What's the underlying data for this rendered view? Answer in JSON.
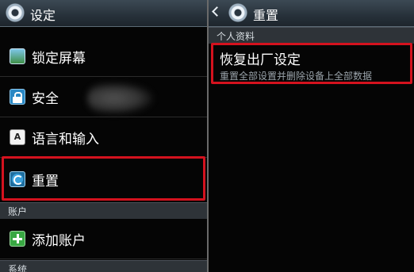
{
  "left": {
    "title": "设定",
    "items": [
      {
        "label": "锁定屏幕",
        "icon": "screen-lock-icon"
      },
      {
        "label": "安全",
        "icon": "lock-icon"
      },
      {
        "label": "语言和输入",
        "icon": "language-icon"
      },
      {
        "label": "重置",
        "icon": "reset-icon"
      }
    ],
    "section_accounts": "账户",
    "add_account": {
      "label": "添加账户",
      "icon": "add-icon"
    },
    "section_system": "系统"
  },
  "right": {
    "title": "重置",
    "section": "个人资料",
    "factory_reset": {
      "label": "恢复出厂设定",
      "description": "重置全部设置并删除设备上全部数据"
    }
  },
  "colors": {
    "highlight": "#d4121e",
    "titlebar": "#27313a",
    "section_header": "#2e3338"
  }
}
